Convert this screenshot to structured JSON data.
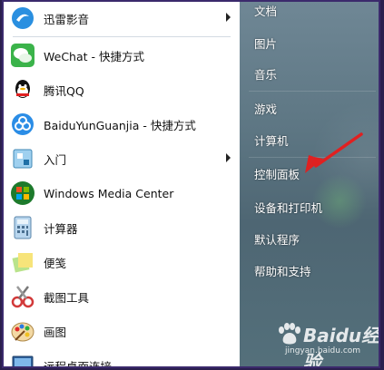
{
  "programs": [
    {
      "label": "迅雷影音",
      "icon": "xunlei-icon",
      "submenu": true
    },
    {
      "label": "WeChat - 快捷方式",
      "icon": "wechat-icon",
      "submenu": false
    },
    {
      "label": "腾讯QQ",
      "icon": "qq-icon",
      "submenu": false
    },
    {
      "label": "BaiduYunGuanjia - 快捷方式",
      "icon": "baidu-yun-icon",
      "submenu": false
    },
    {
      "label": "入门",
      "icon": "getting-started-icon",
      "submenu": true
    },
    {
      "label": "Windows Media Center",
      "icon": "windows-media-center-icon",
      "submenu": false
    },
    {
      "label": "计算器",
      "icon": "calculator-icon",
      "submenu": false
    },
    {
      "label": "便笺",
      "icon": "sticky-notes-icon",
      "submenu": false
    },
    {
      "label": "截图工具",
      "icon": "snipping-tool-icon",
      "submenu": false
    },
    {
      "label": "画图",
      "icon": "paint-icon",
      "submenu": false
    },
    {
      "label": "远程桌面连接",
      "icon": "remote-desktop-icon",
      "submenu": false
    }
  ],
  "right_pane": {
    "items": [
      "文档",
      "图片",
      "音乐",
      "游戏",
      "计算机",
      "控制面板",
      "设备和打印机",
      "默认程序",
      "帮助和支持"
    ]
  },
  "annotation": {
    "color": "#e02020",
    "target": "控制面板"
  },
  "watermark": {
    "brand": "Baidu经验",
    "url": "jingyan.baidu.com"
  }
}
